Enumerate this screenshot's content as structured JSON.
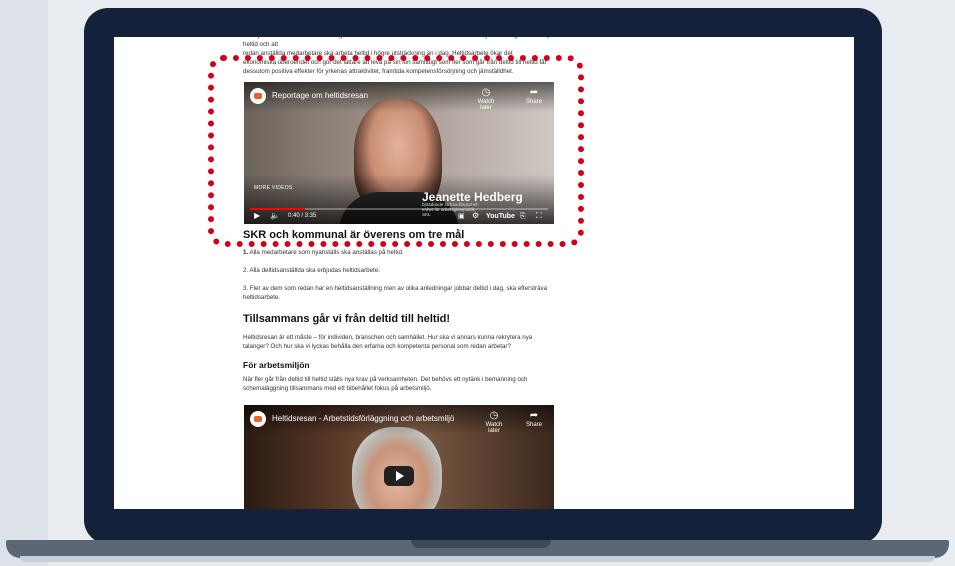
{
  "article": {
    "intro_lines": [
      "Våra jämställdhetsmålen är en viktig del i arbetet med heltidsresan. Det handlar om att nyanställningar ska ske på heltid och att",
      "redan anställda medarbetare ska arbeta heltid i högre utsträckning än i dag. Heltidsarbete ökar det",
      "ekonomiska oberoendet och gör det lättare att leva på sin lön samtidigt som fler som går från deltid till heltid får",
      "dessutom positiva effekter för yrkenas attraktivitet, framtida kompetensförsörjning och jämställdhet."
    ],
    "heading_goals": "SKR och kommunal är överens om tre mål",
    "goals": [
      {
        "num": "1.",
        "text": " Alla medarbetare som nyanställs ska anställas på heltid."
      },
      {
        "num": "2.",
        "text": " Alla deltidsanställda ska erbjudas heltidsarbete."
      },
      {
        "num": "3.",
        "text": " Fler av dem som redan har en heltidsanställning men av olika anledningar jobbar deltid i dag, ska eftersträva heltidsarbete."
      }
    ],
    "heading_together": "Tillsammans går vi från deltid till heltid!",
    "para_together": "Heltidsresan är ett måste – för individen, branschen och samhället. Hur ska vi annars kunna rekrytera nya talanger? Och hur ska vi lyckas behålla den erfarna och kompetenta personal som redan arbetar?",
    "heading_env": "För arbetsmiljön",
    "para_env": "När fler går från deltid till heltid ställs nya krav på verksamheten. Det behövs ett nytänk i bemanning och schemaläggning tillsammans med ett bibehållet fokus på arbetsmiljö."
  },
  "video1": {
    "title": "Reportage om heltidsresan",
    "watch_later": "Watch later",
    "share": "Share",
    "more_videos": "MORE VIDEOS",
    "person_name": "Jeanette Hedberg",
    "person_role": "biträdande förhandlingschef, enhet för arbetsgivarpolitik, SKL",
    "time": "0:40 / 3:35",
    "youtube": "YouTube",
    "progress": 0.186
  },
  "video2": {
    "title": "Heltidsresan - Arbetstidsförläggning och arbetsmiljö",
    "watch_later": "Watch later",
    "share": "Share"
  },
  "colors": {
    "highlight": "#d0021b",
    "laptop": "#14213a",
    "progress": "#ff0000"
  }
}
